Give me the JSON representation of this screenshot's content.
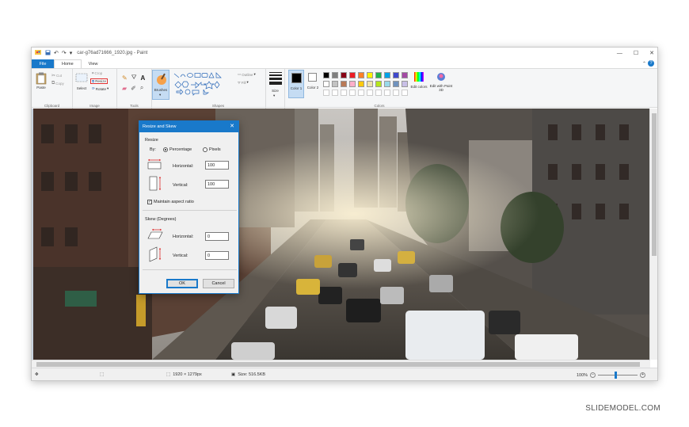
{
  "window": {
    "title": "car-g76ad71666_1920.jpg - Paint",
    "controls": [
      "—",
      "☐",
      "✕"
    ]
  },
  "tabs": [
    {
      "label": "File"
    },
    {
      "label": "Home"
    },
    {
      "label": "View"
    }
  ],
  "ribbon": {
    "clipboard": {
      "paste": "Paste",
      "cut": "Cut",
      "copy": "Copy",
      "label": "Clipboard"
    },
    "image": {
      "select": "Select",
      "crop": "Crop",
      "resize": "Resize",
      "rotate": "Rotate",
      "label": "Image"
    },
    "tools": {
      "label": "Tools"
    },
    "brushes": {
      "label": "Brushes"
    },
    "shapes": {
      "outline": "Outline",
      "fill": "Fill",
      "label": "Shapes"
    },
    "size": {
      "label": "Size"
    },
    "colors": {
      "color1": "Color 1",
      "color2": "Color 2",
      "edit_colors": "Edit colors",
      "edit_paint3d": "Edit with Paint 3D",
      "label": "Colors",
      "palette_row1": [
        "#000000",
        "#7f7f7f",
        "#880015",
        "#ed1c24",
        "#ff7f27",
        "#fff200",
        "#22b14c",
        "#00a2e8",
        "#3f48cc",
        "#a349a4"
      ],
      "palette_row2": [
        "#ffffff",
        "#c3c3c3",
        "#b97a57",
        "#ffaec9",
        "#ffc90e",
        "#efe4b0",
        "#b5e61d",
        "#99d9ea",
        "#7092be",
        "#c8bfe7"
      ]
    }
  },
  "dialog": {
    "title": "Resize and Skew",
    "close": "✕",
    "resize_section": "Resize",
    "by_label": "By:",
    "percentage": "Percentage",
    "pixels": "Pixels",
    "horizontal": "Horizontal:",
    "vertical": "Vertical:",
    "resize_h": "100",
    "resize_v": "100",
    "maintain": "Maintain aspect ratio",
    "skew_section": "Skew (Degrees)",
    "skew_h": "0",
    "skew_v": "0",
    "ok": "OK",
    "cancel": "Cancel"
  },
  "status": {
    "dimensions": "1920 × 1279px",
    "size": "Size: 516.5KB",
    "zoom": "100%"
  },
  "watermark": "SLIDEMODEL.COM"
}
